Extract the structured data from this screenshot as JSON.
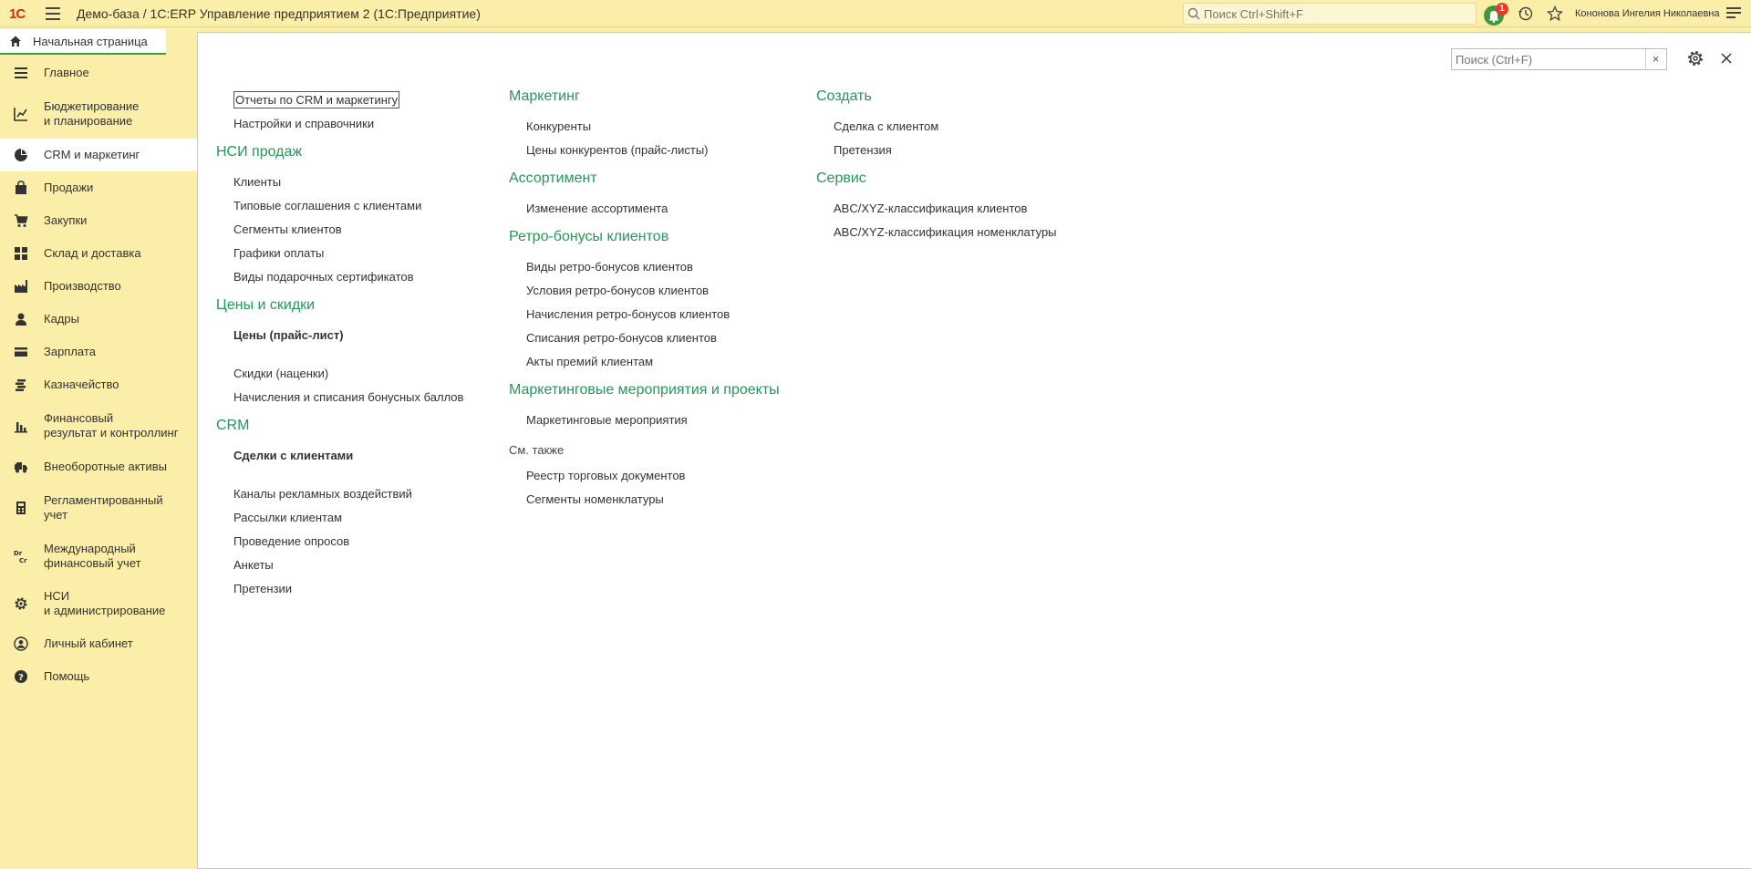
{
  "app": {
    "logo": "1С",
    "title": "Демо-база / 1С:ERP Управление предприятием 2  (1С:Предприятие)",
    "search_placeholder": "Поиск Ctrl+Shift+F",
    "notification_count": "1",
    "user_name": "Кононова Ингелия Николаевна"
  },
  "home_tab": {
    "label": "Начальная страница"
  },
  "sidebar": {
    "items": [
      {
        "label": "Главное",
        "icon": "list-icon"
      },
      {
        "label": "Бюджетирование\nи планирование",
        "icon": "chart-up-icon"
      },
      {
        "label": "CRM и маркетинг",
        "icon": "pie-icon",
        "active": true
      },
      {
        "label": "Продажи",
        "icon": "bag-icon"
      },
      {
        "label": "Закупки",
        "icon": "cart-icon"
      },
      {
        "label": "Склад и доставка",
        "icon": "grid-icon"
      },
      {
        "label": "Производство",
        "icon": "factory-icon"
      },
      {
        "label": "Кадры",
        "icon": "person-icon"
      },
      {
        "label": "Зарплата",
        "icon": "card-icon"
      },
      {
        "label": "Казначейство",
        "icon": "coins-icon"
      },
      {
        "label": "Финансовый\nрезультат и контроллинг",
        "icon": "bars-icon"
      },
      {
        "label": "Внеоборотные активы",
        "icon": "truck-icon"
      },
      {
        "label": "Регламентированный\nучет",
        "icon": "calculator-icon"
      },
      {
        "label": "Международный\nфинансовый учет",
        "icon": "drcr-icon"
      },
      {
        "label": "НСИ\nи администрирование",
        "icon": "gear-icon"
      },
      {
        "label": "Личный кабинет",
        "icon": "user-circle-icon"
      },
      {
        "label": "Помощь",
        "icon": "help-icon"
      }
    ]
  },
  "panel": {
    "search_placeholder": "Поиск (Ctrl+F)",
    "clear_label": "×"
  },
  "col1": {
    "top_links": [
      "Отчеты по CRM и маркетингу",
      "Настройки и справочники"
    ],
    "nsi": {
      "title": "НСИ продаж",
      "links": [
        "Клиенты",
        "Типовые соглашения с клиентами",
        "Сегменты клиентов",
        "Графики оплаты",
        "Виды подарочных сертификатов"
      ]
    },
    "prices": {
      "title": "Цены и скидки",
      "bold": "Цены (прайс-лист)",
      "links": [
        "Скидки (наценки)",
        "Начисления и списания бонусных баллов"
      ]
    },
    "crm": {
      "title": "CRM",
      "bold": "Сделки с клиентами",
      "links": [
        "Каналы рекламных воздействий",
        "Рассылки клиентам",
        "Проведение опросов",
        "Анкеты",
        "Претензии"
      ]
    }
  },
  "col2": {
    "marketing": {
      "title": "Маркетинг",
      "links": [
        "Конкуренты",
        "Цены конкурентов (прайс-листы)"
      ]
    },
    "assortment": {
      "title": "Ассортимент",
      "links": [
        "Изменение ассортимента"
      ]
    },
    "retro": {
      "title": "Ретро-бонусы клиентов",
      "links": [
        "Виды ретро-бонусов клиентов",
        "Условия ретро-бонусов клиентов",
        "Начисления ретро-бонусов клиентов",
        "Списания ретро-бонусов клиентов",
        "Акты премий клиентам"
      ]
    },
    "events": {
      "title": "Маркетинговые мероприятия и проекты",
      "links": [
        "Маркетинговые мероприятия"
      ]
    },
    "see_also": {
      "title": "См. также",
      "links": [
        "Реестр торговых документов",
        "Сегменты номенклатуры"
      ]
    }
  },
  "col3": {
    "create": {
      "title": "Создать",
      "links": [
        "Сделка с клиентом",
        "Претензия"
      ]
    },
    "service": {
      "title": "Сервис",
      "links": [
        "ABC/XYZ-классификация клиентов",
        "ABC/XYZ-классификация номенклатуры"
      ]
    }
  },
  "colors": {
    "section": "#24985a",
    "sidebar_bg": "#fbeea9",
    "accent": "#2f9f4f"
  }
}
